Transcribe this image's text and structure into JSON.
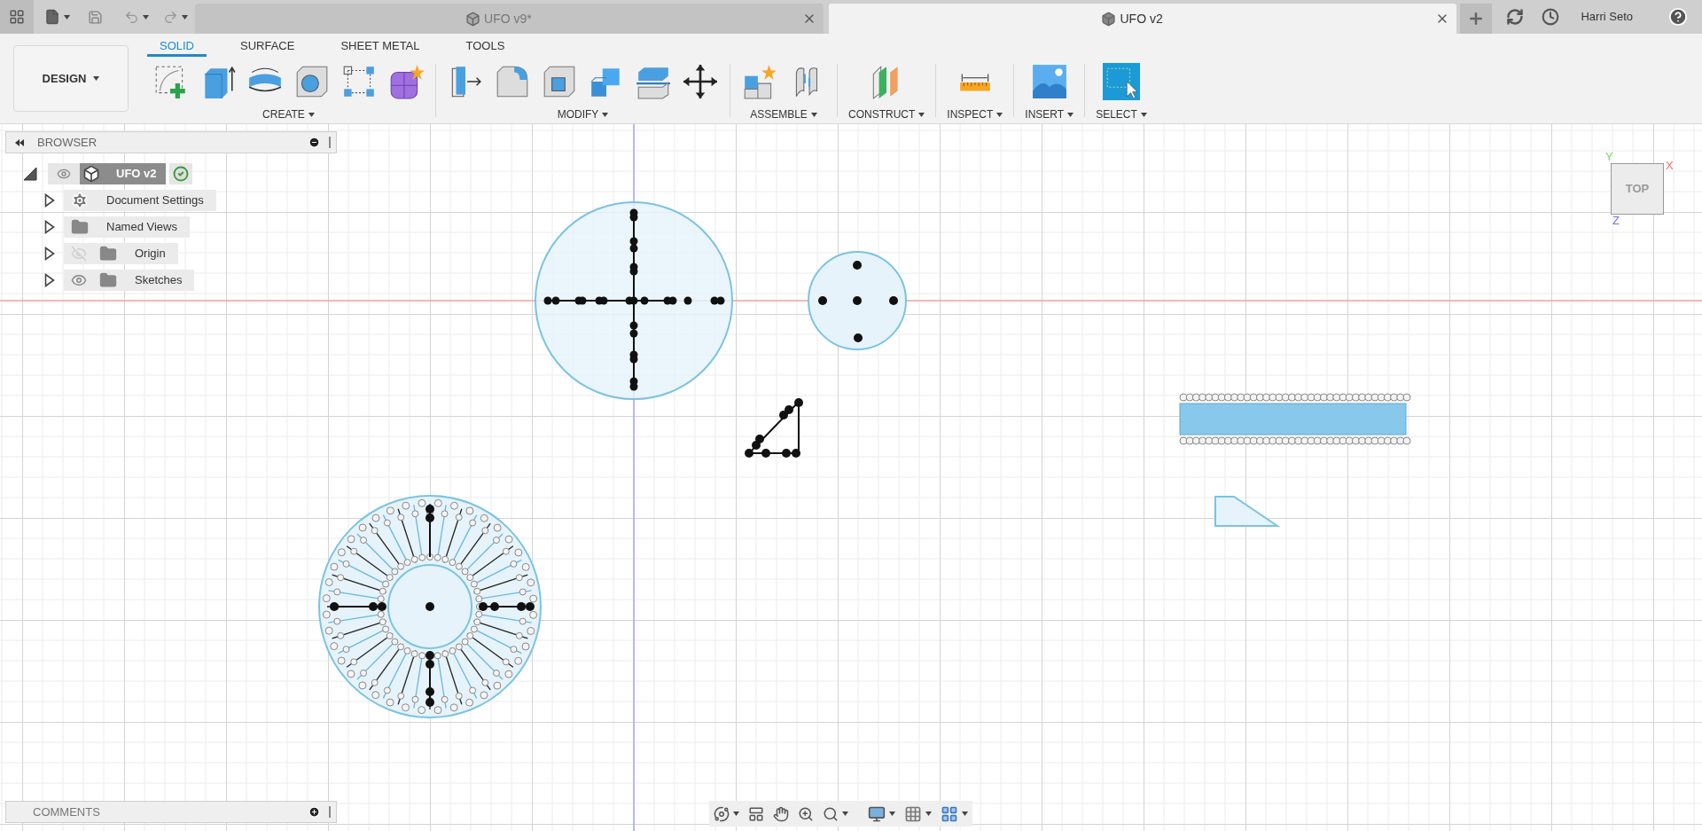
{
  "document_tabs": [
    {
      "title": "UFO v9*",
      "selected": false
    },
    {
      "title": "UFO v2",
      "selected": true
    }
  ],
  "user": {
    "name": "Harri Seto"
  },
  "workspace": {
    "label": "DESIGN"
  },
  "toolbar_tabs": [
    {
      "label": "SOLID",
      "selected": true
    },
    {
      "label": "SURFACE",
      "selected": false
    },
    {
      "label": "SHEET METAL",
      "selected": false
    },
    {
      "label": "TOOLS",
      "selected": false
    }
  ],
  "tool_groups": [
    {
      "label": "CREATE"
    },
    {
      "label": "MODIFY"
    },
    {
      "label": "ASSEMBLE"
    },
    {
      "label": "CONSTRUCT"
    },
    {
      "label": "INSPECT"
    },
    {
      "label": "INSERT"
    },
    {
      "label": "SELECT"
    }
  ],
  "browser": {
    "title": "BROWSER",
    "root": {
      "label": "UFO v2",
      "expanded": true,
      "visible": true
    },
    "items": [
      {
        "label": "Document Settings",
        "kind": "settings",
        "expanded": false
      },
      {
        "label": "Named Views",
        "kind": "folder",
        "expanded": false
      },
      {
        "label": "Origin",
        "kind": "toggle_folder",
        "expanded": false,
        "visible": false
      },
      {
        "label": "Sketches",
        "kind": "toggle_folder",
        "expanded": false,
        "visible": true
      }
    ]
  },
  "viewcube": {
    "face": "TOP",
    "axes": [
      {
        "label": "X",
        "color": "#f07070"
      },
      {
        "label": "Y",
        "color": "#70d870"
      },
      {
        "label": "Z",
        "color": "#7070f0"
      }
    ]
  },
  "comments": {
    "title": "COMMENTS"
  }
}
